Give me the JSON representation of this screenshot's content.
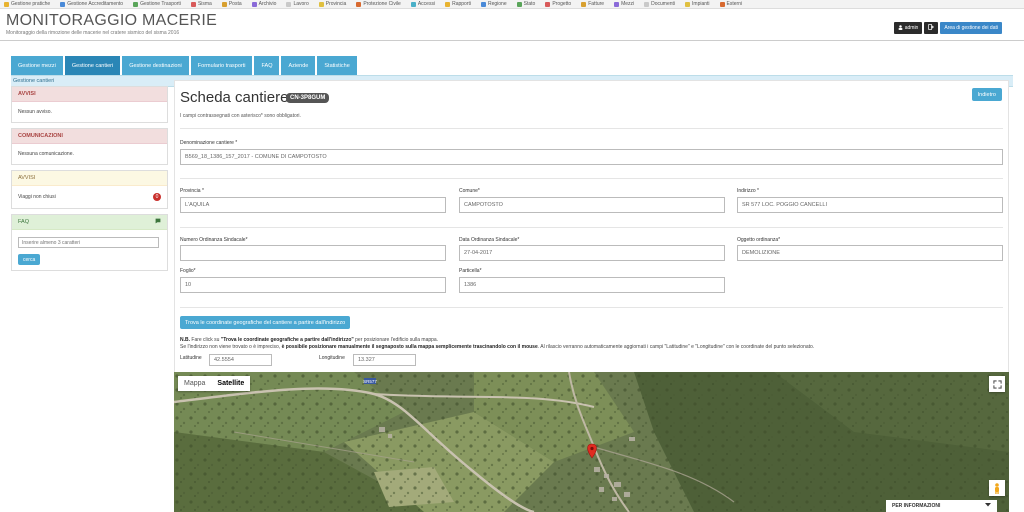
{
  "browser": {
    "bookmarks": [
      "Gestione pratiche",
      "Gestione Accreditamento",
      "Gestione Trasporti",
      "Sisma",
      "Posta",
      "Archivio",
      "Lavoro",
      "Provincia",
      "Protezione Civile",
      "Accessi",
      "Rapporti",
      "Regione",
      "Stato",
      "Progetto",
      "Fatture",
      "Mezzi",
      "Documenti",
      "Impianti",
      "Esterni"
    ]
  },
  "header": {
    "title": "MONITORAGGIO MACERIE",
    "subtitle": "Monitoraggio della rimozione delle macerie nel cratere sismico del sisma 2016",
    "admin_label": "admin",
    "area_label": "Area di gestione dei dati"
  },
  "nav": {
    "tabs": [
      "Gestione mezzi",
      "Gestione cantieri",
      "Gestione destinazioni",
      "Formulario trasporti",
      "FAQ",
      "Aziende",
      "Statistiche"
    ]
  },
  "subbar": {
    "label": "Gestione cantieri"
  },
  "sidebar": {
    "avvisi_title": "AVVISI",
    "avvisi_body": "Nessun avviso.",
    "comunicazioni_title": "COMUNICAZIONI",
    "comunicazioni_body": "Nessuna comunicazione.",
    "avvisi2_title": "AVVISI",
    "viaggi_label": "Viaggi non chiusi",
    "viaggi_count": "0",
    "faq_title": "FAQ",
    "faq_placeholder": "Inserire almeno 3 caratteri",
    "faq_button": "cerca"
  },
  "main": {
    "title": "Scheda cantiere",
    "code": "CN-3P8GUM",
    "back_button": "Indietro",
    "note": "I campi contrassegnati con asterisco* sono obbligatori.",
    "fields": {
      "denominazione": {
        "label": "Denominazione cantiere *",
        "value": "B569_18_1386_157_2017 - COMUNE DI CAMPOTOSTO"
      },
      "provincia": {
        "label": "Provincia *",
        "value": "L'AQUILA"
      },
      "comune": {
        "label": "Comune*",
        "value": "CAMPOTOSTO"
      },
      "indirizzo": {
        "label": "Indirizzo *",
        "value": "SR 577 LOC. POGGIO CANCELLI"
      },
      "numero_ordinanza": {
        "label": "Numero Ordinanza Sindacale*",
        "value": ""
      },
      "data_ordinanza": {
        "label": "Data Ordinanza Sindacale*",
        "value": "27-04-2017"
      },
      "oggetto_ordinanza": {
        "label": "Oggetto ordinanza*",
        "value": "DEMOLIZIONE"
      },
      "foglio": {
        "label": "Foglio*",
        "value": "10"
      },
      "particella": {
        "label": "Particella*",
        "value": "1386"
      }
    },
    "geo_button": "Trova le coordinate geografiche del cantiere a partire dall'indirizzo",
    "nb_prefix": "N.B.",
    "nb_line1_a": "Fare click su ",
    "nb_line1_b": "\"Trova le coordinate geografiche a partire dall'indirizzo\"",
    "nb_line1_c": " per posizionare l'edificio sulla mappa.",
    "nb_line2_a": "Se l'indirizzo non viene trovato o è impreciso, ",
    "nb_line2_b": "è possibile posizionare manualmente il segnaposto sulla mappa semplicemente trascinandolo con il mouse",
    "nb_line2_c": ". Al rilascio verranno automaticamente aggiornati i campi \"Latitudine\" e \"Longitudine\" con le coordinate del punto selezionato.",
    "latitudine_label": "Latitudine",
    "latitudine_value": "42.5554",
    "longitudine_label": "Longitudine",
    "longitudine_value": "13.327",
    "map": {
      "tab_mappa": "Mappa",
      "tab_satellite": "Satellite",
      "road_label": "SR577",
      "info_label": "PER INFORMAZIONI"
    }
  },
  "colors": {
    "primary": "#4aa8d2",
    "active_tab": "#2a86b6",
    "header_blue": "#3a87c8",
    "badge_dark": "#555555"
  }
}
